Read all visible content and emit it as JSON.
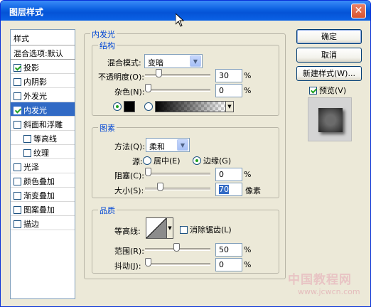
{
  "window": {
    "title": "图层样式",
    "close_glyph": "✕"
  },
  "style_list": {
    "header": "样式",
    "blend_options": "混合选项:默认",
    "items": [
      {
        "label": "投影",
        "checked": true,
        "indent": false,
        "selected": false
      },
      {
        "label": "内阴影",
        "checked": false,
        "indent": false,
        "selected": false
      },
      {
        "label": "外发光",
        "checked": false,
        "indent": false,
        "selected": false
      },
      {
        "label": "内发光",
        "checked": true,
        "indent": false,
        "selected": true
      },
      {
        "label": "斜面和浮雕",
        "checked": false,
        "indent": false,
        "selected": false
      },
      {
        "label": "等高线",
        "checked": false,
        "indent": true,
        "selected": false
      },
      {
        "label": "纹理",
        "checked": false,
        "indent": true,
        "selected": false
      },
      {
        "label": "光泽",
        "checked": false,
        "indent": false,
        "selected": false
      },
      {
        "label": "颜色叠加",
        "checked": false,
        "indent": false,
        "selected": false
      },
      {
        "label": "渐变叠加",
        "checked": false,
        "indent": false,
        "selected": false
      },
      {
        "label": "图案叠加",
        "checked": false,
        "indent": false,
        "selected": false
      },
      {
        "label": "描边",
        "checked": false,
        "indent": false,
        "selected": false
      }
    ]
  },
  "panel": {
    "title": "内发光",
    "structure": {
      "label": "结构",
      "blend_mode_label": "混合模式:",
      "blend_mode_value": "变暗",
      "opacity_label": "不透明度(O):",
      "opacity_value": "30",
      "opacity_level": 30,
      "noise_label": "杂色(N):",
      "noise_value": "0",
      "noise_level": 0,
      "percent": "%"
    },
    "elements": {
      "label": "图素",
      "method_label": "方法(Q):",
      "method_value": "柔和",
      "source_label": "源:",
      "source_center": "居中(E)",
      "source_edge": "边缘(G)",
      "choke_label": "阻塞(C):",
      "choke_value": "0",
      "choke_level": 0,
      "size_label": "大小(S):",
      "size_value": "70",
      "size_unit": "像素",
      "percent": "%"
    },
    "quality": {
      "label": "品质",
      "contour_label": "等高线:",
      "antialias_label": "消除锯齿(L)",
      "range_label": "范围(R):",
      "range_value": "50",
      "range_level": 50,
      "jitter_label": "抖动(J):",
      "jitter_value": "0",
      "jitter_level": 0,
      "percent": "%"
    }
  },
  "buttons": {
    "ok": "确定",
    "cancel": "取消",
    "new_style": "新建样式(W)...",
    "preview": "预览(V)"
  },
  "watermark": {
    "text": "中国教程网",
    "url": "www.jcwcn.com"
  }
}
